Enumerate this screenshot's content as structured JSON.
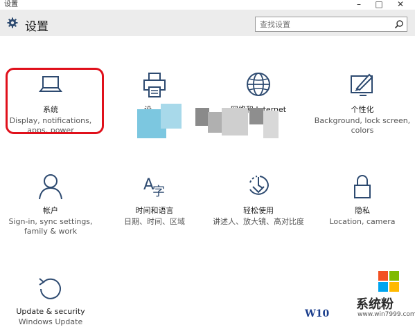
{
  "window": {
    "title": "设置",
    "controls": [
      "minimize",
      "maximize",
      "close"
    ]
  },
  "header": {
    "title": "设置",
    "search_placeholder": "查找设置"
  },
  "tiles": [
    {
      "label": "系统",
      "desc": "Display, notifications, apps, power",
      "icon": "laptop-icon"
    },
    {
      "label": "设",
      "desc": "",
      "icon": "printer-icon"
    },
    {
      "label": "网络和 Internet",
      "desc": "",
      "icon": "globe-icon"
    },
    {
      "label": "个性化",
      "desc": "Background, lock screen, colors",
      "icon": "paint-icon"
    },
    {
      "label": "帐户",
      "desc": "Sign-in, sync settings, family & work",
      "icon": "person-icon"
    },
    {
      "label": "时间和语言",
      "desc": "日期、时间、区域",
      "icon": "language-icon"
    },
    {
      "label": "轻松使用",
      "desc": "讲述人、放大镜、高对比度",
      "icon": "ease-of-access-icon"
    },
    {
      "label": "隐私",
      "desc": "Location, camera",
      "icon": "lock-icon"
    },
    {
      "label": "Update & security",
      "desc": "Windows Update",
      "icon": "refresh-icon"
    }
  ],
  "watermark": {
    "w10": "W10",
    "brand": "系统粉",
    "url": "www.win7999.com"
  },
  "colors": {
    "accent": "#2d4a70",
    "highlight": "#e0101b",
    "header_bg": "#ececec"
  }
}
